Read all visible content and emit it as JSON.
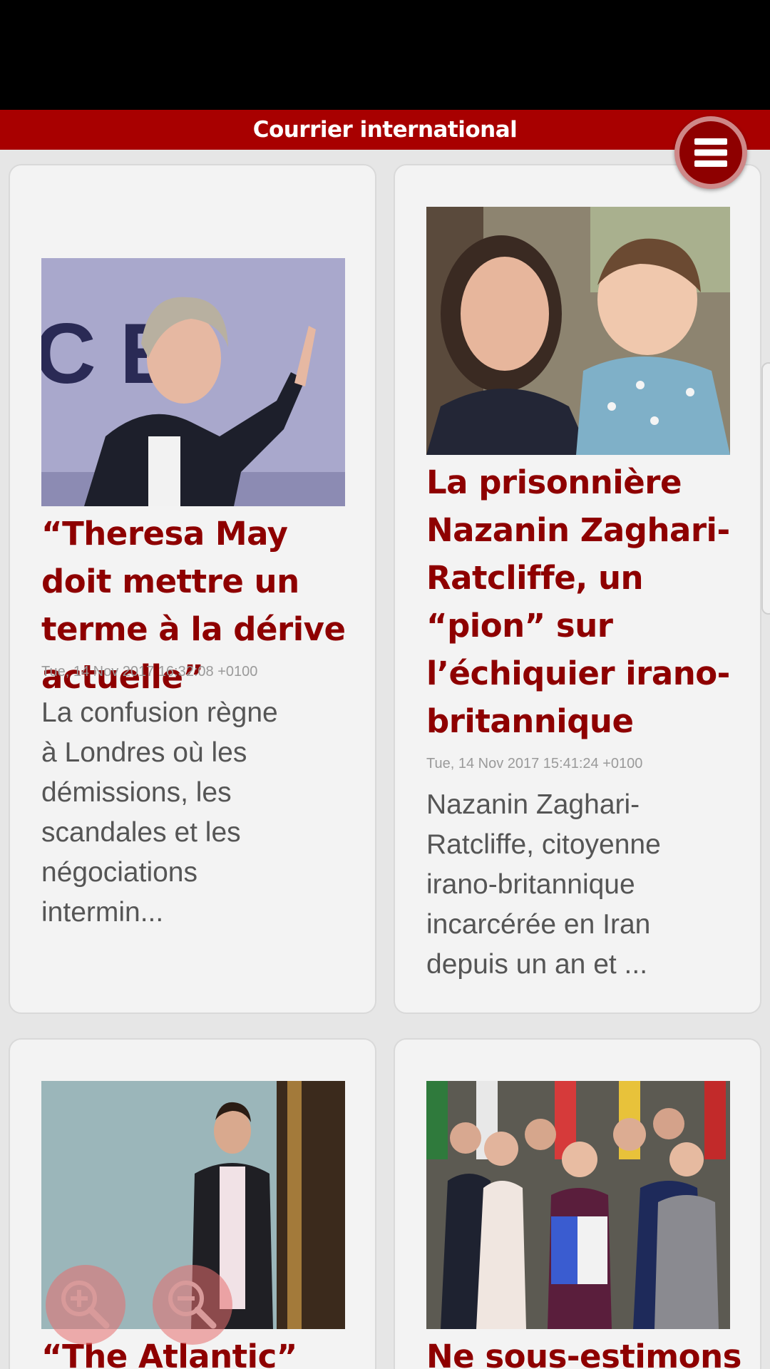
{
  "header": {
    "title": "Courrier international",
    "menu_icon": "hamburger-menu-icon"
  },
  "articles": [
    {
      "headline": "“Theresa May doit mettre un terme à la dérive actuelle”",
      "date": "Tue, 14 Nov 2017 16:32:08 +0100",
      "excerpt": "La confusion règne à Londres où les démissions, les scandales et les négociations intermin..."
    },
    {
      "headline": "La prisonnière Nazanin Zaghari-Ratcliffe, un “pion” sur l’échiquier irano-britannique",
      "date": "Tue, 14 Nov 2017 15:41:24 +0100",
      "excerpt": "Nazanin Zaghari-Ratcliffe, citoyenne irano-britannique incarcérée en Iran depuis un an et ..."
    },
    {
      "headline": "“The Atlantic”"
    },
    {
      "headline": "Ne sous-estimons"
    }
  ],
  "zoom": {
    "in_icon": "zoom-in-icon",
    "out_icon": "zoom-out-icon"
  }
}
